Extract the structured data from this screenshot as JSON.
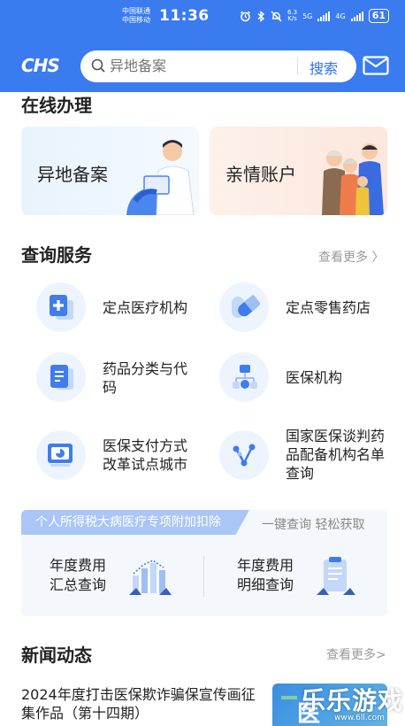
{
  "status_bar": {
    "carrier_1": "中国联通",
    "carrier_2": "中国移动",
    "time": "11:36",
    "speed_value": "6.3",
    "speed_unit": "K/s",
    "net_1": "5G",
    "net_2": "4G",
    "battery": "61"
  },
  "header": {
    "logo": "CHS",
    "search_placeholder": "异地备案",
    "search_button": "搜索",
    "mail_icon": "mail-icon"
  },
  "online": {
    "title": "在线办理",
    "cards": [
      {
        "label": "异地备案"
      },
      {
        "label": "亲情账户"
      }
    ]
  },
  "query": {
    "title": "查询服务",
    "more": "查看更多 〉",
    "items": [
      {
        "label": "定点医疗机构",
        "icon": "hospital-cross-icon"
      },
      {
        "label": "定点零售药店",
        "icon": "pill-icon"
      },
      {
        "label": "药品分类与代码",
        "icon": "document-icon"
      },
      {
        "label": "医保机构",
        "icon": "org-chart-icon"
      },
      {
        "label": "医保支付方式改革试点城市",
        "icon": "pie-chart-icon"
      },
      {
        "label": "国家医保谈判药品配备机构名单查询",
        "icon": "network-icon"
      }
    ]
  },
  "tax": {
    "banner": "个人所得税大病医疗专项附加扣除",
    "tagline": "一键查询 轻松获取",
    "items": [
      {
        "line1": "年度费用",
        "line2": "汇总查询"
      },
      {
        "line1": "年度费用",
        "line2": "明细查询"
      }
    ]
  },
  "news": {
    "title": "新闻动态",
    "more": "查看更多>",
    "first_item": "2024年度打击医保欺诈骗保宣传画征集作品（第十四期）",
    "thumb_text": "医"
  },
  "watermark": {
    "text": "乐乐游戏",
    "url": "www.6ll.com"
  },
  "colors": {
    "header_blue": "#3a7bf0",
    "accent_blue": "#2f6fe8",
    "icon_blue": "#4a86ee",
    "banner_blue": "#a9c6f6"
  }
}
